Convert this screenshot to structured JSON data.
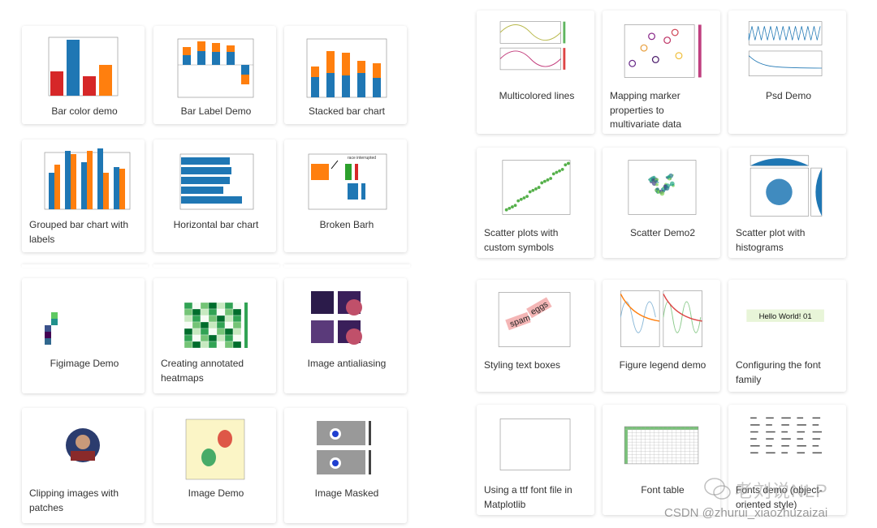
{
  "gallery": {
    "left": [
      {
        "title": "Bar color demo"
      },
      {
        "title": "Bar Label Demo"
      },
      {
        "title": "Stacked bar chart"
      },
      {
        "title": "Grouped bar chart with labels"
      },
      {
        "title": "Horizontal bar chart"
      },
      {
        "title": "Broken Barh"
      },
      {
        "title": "Figimage Demo"
      },
      {
        "title": "Creating annotated heatmaps"
      },
      {
        "title": "Image antialiasing"
      },
      {
        "title": "Clipping images with patches"
      },
      {
        "title": "Image Demo"
      },
      {
        "title": "Image Masked"
      }
    ],
    "right": [
      {
        "title": "Multicolored lines"
      },
      {
        "title": "Mapping marker properties to multivariate data"
      },
      {
        "title": "Psd Demo"
      },
      {
        "title": "Scatter plots with custom symbols"
      },
      {
        "title": "Scatter Demo2"
      },
      {
        "title": "Scatter plot with histograms"
      },
      {
        "title": "Styling text boxes"
      },
      {
        "title": "Figure legend demo"
      },
      {
        "title": "Configuring the font family"
      },
      {
        "title": "Using a ttf font file in Matplotlib"
      },
      {
        "title": "Font table"
      },
      {
        "title": "Fonts demo (object-oriented style)"
      }
    ]
  },
  "thumb_text": {
    "eggs": "eggs",
    "spam": "spam",
    "hello": "Hello World! 01",
    "race": "race interrupted"
  },
  "colors": {
    "blue": "#1f77b4",
    "orange": "#ff7f0e",
    "red": "#d62728",
    "green": "#2ca02c"
  },
  "watermark": {
    "wechat_name": "老刘说NLP",
    "csdn": "CSDN @zhurui_xiaozhuzaizai"
  }
}
